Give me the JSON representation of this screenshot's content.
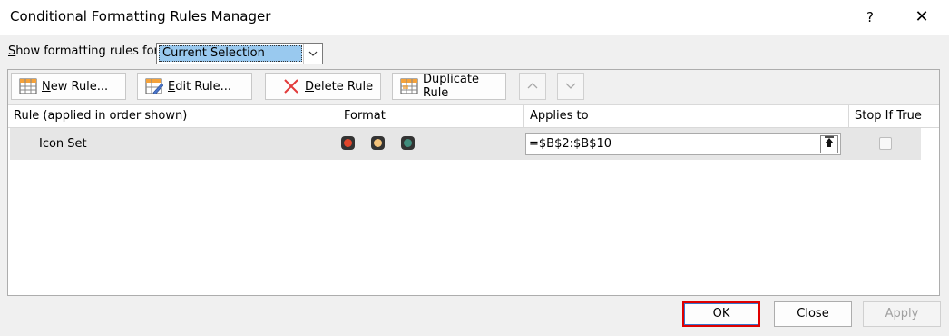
{
  "window": {
    "title": "Conditional Formatting Rules Manager",
    "help_label": "?",
    "close_label": "✕"
  },
  "show_rules": {
    "label_prefix": "S",
    "label_rest": "how formatting rules for:",
    "selected": "Current Selection"
  },
  "toolbar": {
    "new_rule": {
      "prefix": "",
      "underline": "N",
      "rest": "ew Rule..."
    },
    "edit_rule": {
      "prefix": "",
      "underline": "E",
      "rest": "dit Rule..."
    },
    "delete_rule": {
      "prefix": "",
      "underline": "D",
      "rest": "elete Rule"
    },
    "duplicate_rule": {
      "prefix": "Dupli",
      "underline": "c",
      "rest": "ate Rule"
    },
    "move_up_icon": "chevron-up-icon",
    "move_down_icon": "chevron-down-icon"
  },
  "table": {
    "headers": [
      "Rule (applied in order shown)",
      "Format",
      "Applies to",
      "Stop If True"
    ],
    "rows": [
      {
        "rule": "Icon Set",
        "format_icons": [
          {
            "name": "red-circle-icon",
            "color": "#e0452b"
          },
          {
            "name": "yellow-circle-icon",
            "color": "#f3c27a"
          },
          {
            "name": "green-circle-icon",
            "color": "#3f8c7c"
          }
        ],
        "applies_to": "=$B$2:$B$10",
        "stop_if_true": false
      }
    ]
  },
  "buttons": {
    "ok": "OK",
    "close": "Close",
    "apply": "Apply"
  },
  "colors": {
    "highlight": "#e00000",
    "selection": "#99c9ef"
  }
}
